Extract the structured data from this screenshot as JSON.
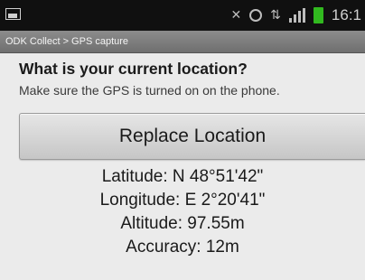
{
  "status_bar": {
    "clock": "16:1",
    "icons": [
      "image-notification-icon",
      "mute-icon",
      "alarm-icon",
      "data-icon",
      "signal-icon",
      "battery-icon"
    ],
    "colors": {
      "background": "#101010",
      "icon": "#bdbdbd",
      "battery": "#31b91f"
    }
  },
  "title_bar": {
    "title": "ODK Collect > GPS capture"
  },
  "question": {
    "label": "What is your current location?",
    "hint": "Make sure the GPS is turned on on the phone."
  },
  "action": {
    "replace_label": "Replace Location"
  },
  "location": {
    "latitude": "Latitude: N 48°51'42\"",
    "longitude": "Longitude: E 2°20'41\"",
    "altitude": "Altitude: 97.55m",
    "accuracy": "Accuracy: 12m"
  }
}
